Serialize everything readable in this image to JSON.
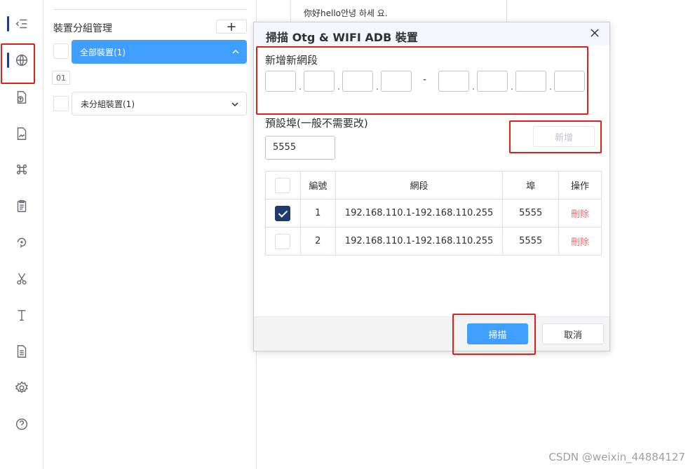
{
  "group_panel": {
    "title": "裝置分組管理",
    "add_label": "+",
    "device_badge": "01",
    "groups": [
      {
        "label": "全部裝置(1)",
        "active": true
      },
      {
        "label": "未分組裝置(1)",
        "active": false
      }
    ]
  },
  "background_card": {
    "text": "你好hello안녕 하세 요."
  },
  "dialog": {
    "title": "掃描 Otg & WIFI ADB 裝置",
    "segment_label": "新增新網段",
    "ip_separator": ".",
    "range_dash": "-",
    "port_label": "預設埠(一般不需要改)",
    "port_value": "5555",
    "add_button": "新增",
    "table": {
      "headers": [
        "",
        "編號",
        "網段",
        "埠",
        "操作"
      ],
      "rows": [
        {
          "checked": true,
          "id": "1",
          "segment": "192.168.110.1-192.168.110.255",
          "port": "5555",
          "action": "刪除"
        },
        {
          "checked": false,
          "id": "2",
          "segment": "192.168.110.1-192.168.110.255",
          "port": "5555",
          "action": "刪除"
        }
      ]
    },
    "scan_button": "掃描",
    "cancel_button": "取消"
  },
  "watermark": "CSDN @weixin_44884127",
  "colors": {
    "primary": "#409eff",
    "annotation_red": "#e0201a",
    "checkbox_checked": "#1e3a6e",
    "delete_link": "#f56c6c"
  },
  "rail_icons": [
    "collapse-menu-icon",
    "network-globe-icon",
    "file-upload-icon",
    "image-file-icon",
    "command-key-icon",
    "clipboard-icon",
    "rotate-icon",
    "scissors-icon",
    "text-icon",
    "document-icon",
    "gear-icon",
    "help-icon"
  ]
}
